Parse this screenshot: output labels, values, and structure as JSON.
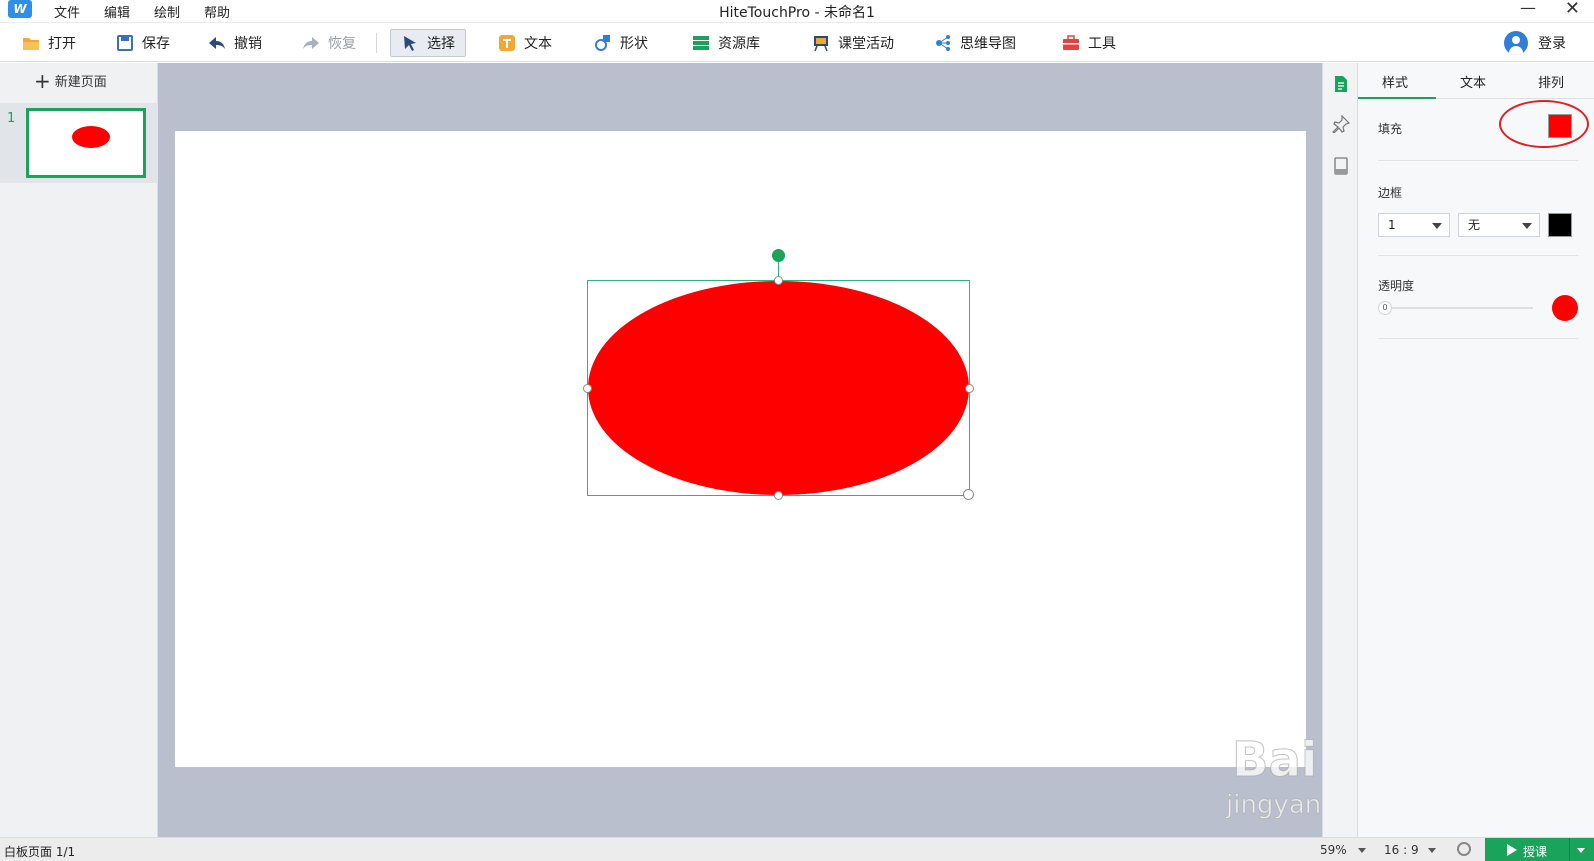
{
  "titlebar": {
    "app_logo": "W",
    "menu": [
      "文件",
      "编辑",
      "绘制",
      "帮助"
    ],
    "title": "HiteTouchPro - 未命名1",
    "minimize": "—",
    "close": "✕"
  },
  "toolbar": {
    "open": "打开",
    "save": "保存",
    "undo": "撤销",
    "redo": "恢复",
    "select": "选择",
    "text": "文本",
    "shape": "形状",
    "resources": "资源库",
    "class_activity": "课堂活动",
    "mind_map": "思维导图",
    "tools": "工具",
    "login": "登录"
  },
  "left_panel": {
    "new_page": "新建页面",
    "new_page_icon": "plus-icon",
    "pages": [
      {
        "number": "1"
      }
    ]
  },
  "canvas": {
    "shape": {
      "type": "ellipse",
      "fill": "#ff0000",
      "selected": true
    },
    "selection_color": "#2fb37a"
  },
  "props": {
    "tabs": [
      "样式",
      "文本",
      "排列"
    ],
    "active_tab": "样式",
    "fill_label": "填充",
    "fill_color": "#ff0000",
    "border_label": "边框",
    "border_width": "1",
    "border_style": "无",
    "border_color": "#000000",
    "opacity_label": "透明度",
    "opacity_value": "0",
    "opacity_color": "#ff0000"
  },
  "statusbar": {
    "page_info": "白板页面 1/1",
    "zoom": "59%",
    "ratio": "16 : 9",
    "teach": "授课"
  },
  "watermark": {
    "brand": "Bai du 经验",
    "url": "jingyan.baidu.com"
  },
  "colors": {
    "accent": "#1aa35b",
    "canvas_bg": "#b9bfcc"
  }
}
